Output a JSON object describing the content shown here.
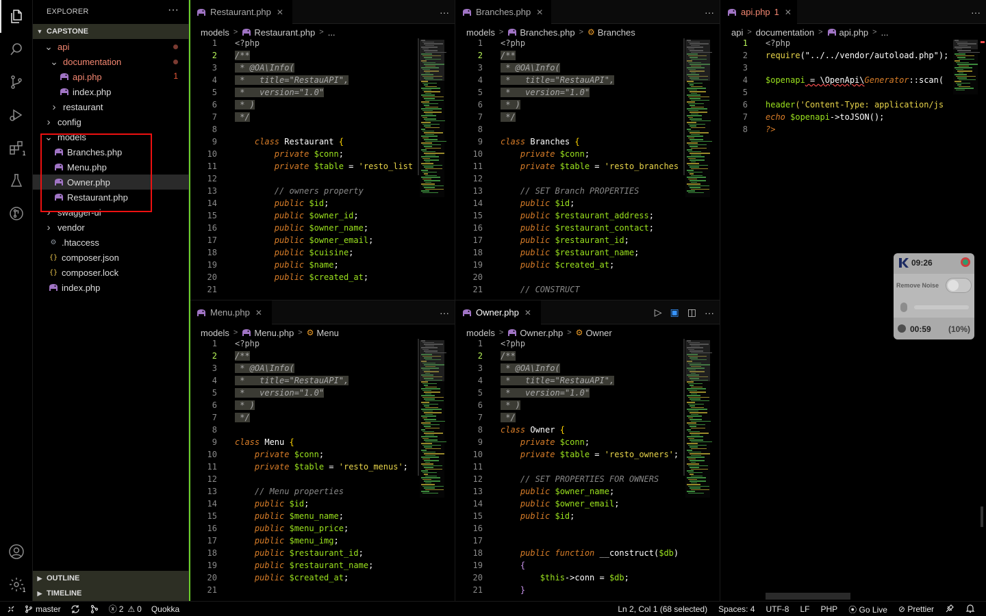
{
  "explorer": {
    "title": "EXPLORER",
    "root": "CAPSTONE",
    "tree": [
      {
        "name": "api",
        "indent": 1,
        "kind": "folder-open",
        "status": "dot",
        "color": "red"
      },
      {
        "name": "documentation",
        "indent": 2,
        "kind": "folder-open",
        "status": "dot",
        "color": "red"
      },
      {
        "name": "api.php",
        "indent": 3,
        "kind": "php",
        "status_count": "1",
        "color": "red"
      },
      {
        "name": "index.php",
        "indent": 3,
        "kind": "php"
      },
      {
        "name": "restaurant",
        "indent": 2,
        "kind": "folder"
      },
      {
        "name": "config",
        "indent": 1,
        "kind": "folder"
      },
      {
        "name": "models",
        "indent": 1,
        "kind": "folder-open"
      },
      {
        "name": "Branches.php",
        "indent": 2,
        "kind": "php"
      },
      {
        "name": "Menu.php",
        "indent": 2,
        "kind": "php"
      },
      {
        "name": "Owner.php",
        "indent": 2,
        "kind": "php",
        "selected": true
      },
      {
        "name": "Restaurant.php",
        "indent": 2,
        "kind": "php"
      },
      {
        "name": "swagger-ui",
        "indent": 1,
        "kind": "folder"
      },
      {
        "name": "vendor",
        "indent": 1,
        "kind": "folder"
      },
      {
        "name": ".htaccess",
        "indent": 1,
        "kind": "gear"
      },
      {
        "name": "composer.json",
        "indent": 1,
        "kind": "json"
      },
      {
        "name": "composer.lock",
        "indent": 1,
        "kind": "json"
      },
      {
        "name": "index.php",
        "indent": 1,
        "kind": "php"
      }
    ],
    "outline": "OUTLINE",
    "timeline": "TIMELINE"
  },
  "activity_badges": {
    "extensions": "1",
    "settings": "1"
  },
  "editors": {
    "restaurant": {
      "tab": "Restaurant.php",
      "crumbs": [
        "models",
        "Restaurant.php",
        "..."
      ],
      "first_line": 1,
      "current_line": 2,
      "lines": [
        [
          [
            "c-php",
            "<?php"
          ]
        ],
        [
          [
            "c-cmhl",
            "/**"
          ]
        ],
        [
          [
            "c-cmhl",
            " * @OA\\Info("
          ]
        ],
        [
          [
            "c-cmhl",
            " *   title=\"RestauAPI\","
          ]
        ],
        [
          [
            "c-cmhl",
            " *   version=\"1.0\""
          ]
        ],
        [
          [
            "c-cmhl",
            " * )"
          ]
        ],
        [
          [
            "c-cmhl",
            " */"
          ]
        ],
        [],
        [
          [
            "c-kw",
            "    class "
          ],
          [
            "c-cls",
            "Restaurant "
          ],
          [
            "c-br",
            "{"
          ]
        ],
        [
          [
            "c-kw",
            "        private "
          ],
          [
            "c-var",
            "$conn"
          ],
          [
            "c-pun",
            ";"
          ]
        ],
        [
          [
            "c-kw",
            "        private "
          ],
          [
            "c-var",
            "$table"
          ],
          [
            "c-pun",
            " = "
          ],
          [
            "c-str",
            "'resto_list"
          ]
        ],
        [],
        [
          [
            "c-cm",
            "        // owners property"
          ]
        ],
        [
          [
            "c-kw",
            "        public "
          ],
          [
            "c-var",
            "$id"
          ],
          [
            "c-pun",
            ";"
          ]
        ],
        [
          [
            "c-kw",
            "        public "
          ],
          [
            "c-var",
            "$owner_id"
          ],
          [
            "c-pun",
            ";"
          ]
        ],
        [
          [
            "c-kw",
            "        public "
          ],
          [
            "c-var",
            "$owner_name"
          ],
          [
            "c-pun",
            ";"
          ]
        ],
        [
          [
            "c-kw",
            "        public "
          ],
          [
            "c-var",
            "$owner_email"
          ],
          [
            "c-pun",
            ";"
          ]
        ],
        [
          [
            "c-kw",
            "        public "
          ],
          [
            "c-var",
            "$cuisine"
          ],
          [
            "c-pun",
            ";"
          ]
        ],
        [
          [
            "c-kw",
            "        public "
          ],
          [
            "c-var",
            "$name"
          ],
          [
            "c-pun",
            ";"
          ]
        ],
        [
          [
            "c-kw",
            "        public "
          ],
          [
            "c-var",
            "$created_at"
          ],
          [
            "c-pun",
            ";"
          ]
        ],
        []
      ]
    },
    "branches": {
      "tab": "Branches.php",
      "crumbs": [
        "models",
        "Branches.php",
        "Branches"
      ],
      "first_line": 1,
      "current_line": 2,
      "lines": [
        [
          [
            "c-php",
            "<?php"
          ]
        ],
        [
          [
            "c-cmhl",
            "/**"
          ]
        ],
        [
          [
            "c-cmhl",
            " * @OA\\Info("
          ]
        ],
        [
          [
            "c-cmhl",
            " *   title=\"RestauAPI\","
          ]
        ],
        [
          [
            "c-cmhl",
            " *   version=\"1.0\""
          ]
        ],
        [
          [
            "c-cmhl",
            " * )"
          ]
        ],
        [
          [
            "c-cmhl",
            " */"
          ]
        ],
        [],
        [
          [
            "c-kw",
            "class "
          ],
          [
            "c-cls",
            "Branches "
          ],
          [
            "c-br",
            "{"
          ]
        ],
        [
          [
            "c-kw",
            "    private "
          ],
          [
            "c-var",
            "$conn"
          ],
          [
            "c-pun",
            ";"
          ]
        ],
        [
          [
            "c-kw",
            "    private "
          ],
          [
            "c-var",
            "$table"
          ],
          [
            "c-pun",
            " = "
          ],
          [
            "c-str",
            "'resto_branches"
          ]
        ],
        [],
        [
          [
            "c-cm",
            "    // SET Branch PROPERTIES"
          ]
        ],
        [
          [
            "c-kw",
            "    public "
          ],
          [
            "c-var",
            "$id"
          ],
          [
            "c-pun",
            ";"
          ]
        ],
        [
          [
            "c-kw",
            "    public "
          ],
          [
            "c-var",
            "$restaurant_address"
          ],
          [
            "c-pun",
            ";"
          ]
        ],
        [
          [
            "c-kw",
            "    public "
          ],
          [
            "c-var",
            "$restaurant_contact"
          ],
          [
            "c-pun",
            ";"
          ]
        ],
        [
          [
            "c-kw",
            "    public "
          ],
          [
            "c-var",
            "$restaurant_id"
          ],
          [
            "c-pun",
            ";"
          ]
        ],
        [
          [
            "c-kw",
            "    public "
          ],
          [
            "c-var",
            "$restaurant_name"
          ],
          [
            "c-pun",
            ";"
          ]
        ],
        [
          [
            "c-kw",
            "    public "
          ],
          [
            "c-var",
            "$created_at"
          ],
          [
            "c-pun",
            ";"
          ]
        ],
        [],
        [
          [
            "c-cm",
            "    // CONSTRUCT"
          ]
        ]
      ]
    },
    "api": {
      "tab": "api.php",
      "tab_count": "1",
      "crumbs": [
        "api",
        "documentation",
        "api.php",
        "..."
      ],
      "first_line": 1,
      "current_line": 1,
      "lines": [
        [
          [
            "c-php",
            "<?php"
          ]
        ],
        [
          [
            "c-str",
            "require"
          ],
          [
            "c-pun",
            "(\"../../vendor/autoload.php\");"
          ]
        ],
        [],
        [
          [
            "c-var",
            "$openapi"
          ],
          [
            "c-pun",
            " = \\OpenApi\\"
          ],
          [
            "c-kw",
            "Generator"
          ],
          [
            "c-pun",
            "::scan("
          ]
        ],
        [],
        [
          [
            "c-var",
            "header"
          ],
          [
            "c-str",
            "('Content-Type: application/js"
          ]
        ],
        [
          [
            "c-kw",
            "echo "
          ],
          [
            "c-var",
            "$openapi"
          ],
          [
            "c-pun",
            "->toJSON();"
          ]
        ],
        [
          [
            "c-kw",
            "?>"
          ]
        ]
      ]
    },
    "menu": {
      "tab": "Menu.php",
      "crumbs": [
        "models",
        "Menu.php",
        "Menu"
      ],
      "first_line": 1,
      "current_line": 2,
      "lines": [
        [
          [
            "c-php",
            "<?php"
          ]
        ],
        [
          [
            "c-cmhl",
            "/**"
          ]
        ],
        [
          [
            "c-cmhl",
            " * @OA\\Info("
          ]
        ],
        [
          [
            "c-cmhl",
            " *   title=\"RestauAPI\","
          ]
        ],
        [
          [
            "c-cmhl",
            " *   version=\"1.0\""
          ]
        ],
        [
          [
            "c-cmhl",
            " * )"
          ]
        ],
        [
          [
            "c-cmhl",
            " */"
          ]
        ],
        [],
        [
          [
            "c-kw",
            "class "
          ],
          [
            "c-cls",
            "Menu "
          ],
          [
            "c-br",
            "{"
          ]
        ],
        [
          [
            "c-kw",
            "    private "
          ],
          [
            "c-var",
            "$conn"
          ],
          [
            "c-pun",
            ";"
          ]
        ],
        [
          [
            "c-kw",
            "    private "
          ],
          [
            "c-var",
            "$table"
          ],
          [
            "c-pun",
            " = "
          ],
          [
            "c-str",
            "'resto_menus'"
          ],
          [
            "c-pun",
            ";"
          ]
        ],
        [],
        [
          [
            "c-cm",
            "    // Menu properties"
          ]
        ],
        [
          [
            "c-kw",
            "    public "
          ],
          [
            "c-var",
            "$id"
          ],
          [
            "c-pun",
            ";"
          ]
        ],
        [
          [
            "c-kw",
            "    public "
          ],
          [
            "c-var",
            "$menu_name"
          ],
          [
            "c-pun",
            ";"
          ]
        ],
        [
          [
            "c-kw",
            "    public "
          ],
          [
            "c-var",
            "$menu_price"
          ],
          [
            "c-pun",
            ";"
          ]
        ],
        [
          [
            "c-kw",
            "    public "
          ],
          [
            "c-var",
            "$menu_img"
          ],
          [
            "c-pun",
            ";"
          ]
        ],
        [
          [
            "c-kw",
            "    public "
          ],
          [
            "c-var",
            "$restaurant_id"
          ],
          [
            "c-pun",
            ";"
          ]
        ],
        [
          [
            "c-kw",
            "    public "
          ],
          [
            "c-var",
            "$restaurant_name"
          ],
          [
            "c-pun",
            ";"
          ]
        ],
        [
          [
            "c-kw",
            "    public "
          ],
          [
            "c-var",
            "$created_at"
          ],
          [
            "c-pun",
            ";"
          ]
        ],
        []
      ]
    },
    "owner": {
      "tab": "Owner.php",
      "crumbs": [
        "models",
        "Owner.php",
        "Owner"
      ],
      "first_line": 1,
      "current_line": 2,
      "lines": [
        [
          [
            "c-php",
            "<?php"
          ]
        ],
        [
          [
            "c-cmhl",
            "/**"
          ]
        ],
        [
          [
            "c-cmhl",
            " * @OA\\Info("
          ]
        ],
        [
          [
            "c-cmhl",
            " *   title=\"RestauAPI\","
          ]
        ],
        [
          [
            "c-cmhl",
            " *   version=\"1.0\""
          ]
        ],
        [
          [
            "c-cmhl",
            " * )"
          ]
        ],
        [
          [
            "c-cmhl",
            " */"
          ]
        ],
        [
          [
            "c-kw",
            "class "
          ],
          [
            "c-cls",
            "Owner "
          ],
          [
            "c-br",
            "{"
          ]
        ],
        [
          [
            "c-kw",
            "    private "
          ],
          [
            "c-var",
            "$conn"
          ],
          [
            "c-pun",
            ";"
          ]
        ],
        [
          [
            "c-kw",
            "    private "
          ],
          [
            "c-var",
            "$table"
          ],
          [
            "c-pun",
            " = "
          ],
          [
            "c-str",
            "'resto_owners'"
          ],
          [
            "c-pun",
            ";"
          ]
        ],
        [],
        [
          [
            "c-cm",
            "    // SET PROPERTIES FOR OWNERS"
          ]
        ],
        [
          [
            "c-kw",
            "    public "
          ],
          [
            "c-var",
            "$owner_name"
          ],
          [
            "c-pun",
            ";"
          ]
        ],
        [
          [
            "c-kw",
            "    public "
          ],
          [
            "c-var",
            "$owner_email"
          ],
          [
            "c-pun",
            ";"
          ]
        ],
        [
          [
            "c-kw",
            "    public "
          ],
          [
            "c-var",
            "$id"
          ],
          [
            "c-pun",
            ";"
          ]
        ],
        [],
        [],
        [
          [
            "c-kw",
            "    public function "
          ],
          [
            "c-cls",
            "__construct"
          ],
          [
            "c-pun",
            "("
          ],
          [
            "c-var",
            "$db"
          ],
          [
            "c-pun",
            ")"
          ]
        ],
        [
          [
            "c-fn",
            "    {"
          ]
        ],
        [
          [
            "c-pun",
            "        "
          ],
          [
            "c-var",
            "$this"
          ],
          [
            "c-pun",
            "->conn = "
          ],
          [
            "c-var",
            "$db"
          ],
          [
            "c-pun",
            ";"
          ]
        ],
        [
          [
            "c-fn",
            "    }"
          ]
        ]
      ]
    }
  },
  "widget": {
    "time": "09:26",
    "remove_noise": "Remove Noise",
    "timer": "00:59",
    "percent": "(10%)"
  },
  "status": {
    "branch": "master",
    "errors": "2",
    "warnings": "0",
    "quokka": "Quokka",
    "cursor": "Ln 2, Col 1 (68 selected)",
    "spaces": "Spaces: 4",
    "encoding": "UTF-8",
    "eol": "LF",
    "language": "PHP",
    "golive": "Go Live",
    "prettier": "Prettier"
  },
  "colors": {
    "accent_green": "#9be21e",
    "error_red": "#f14c4c",
    "selection_box": "#e11111"
  }
}
